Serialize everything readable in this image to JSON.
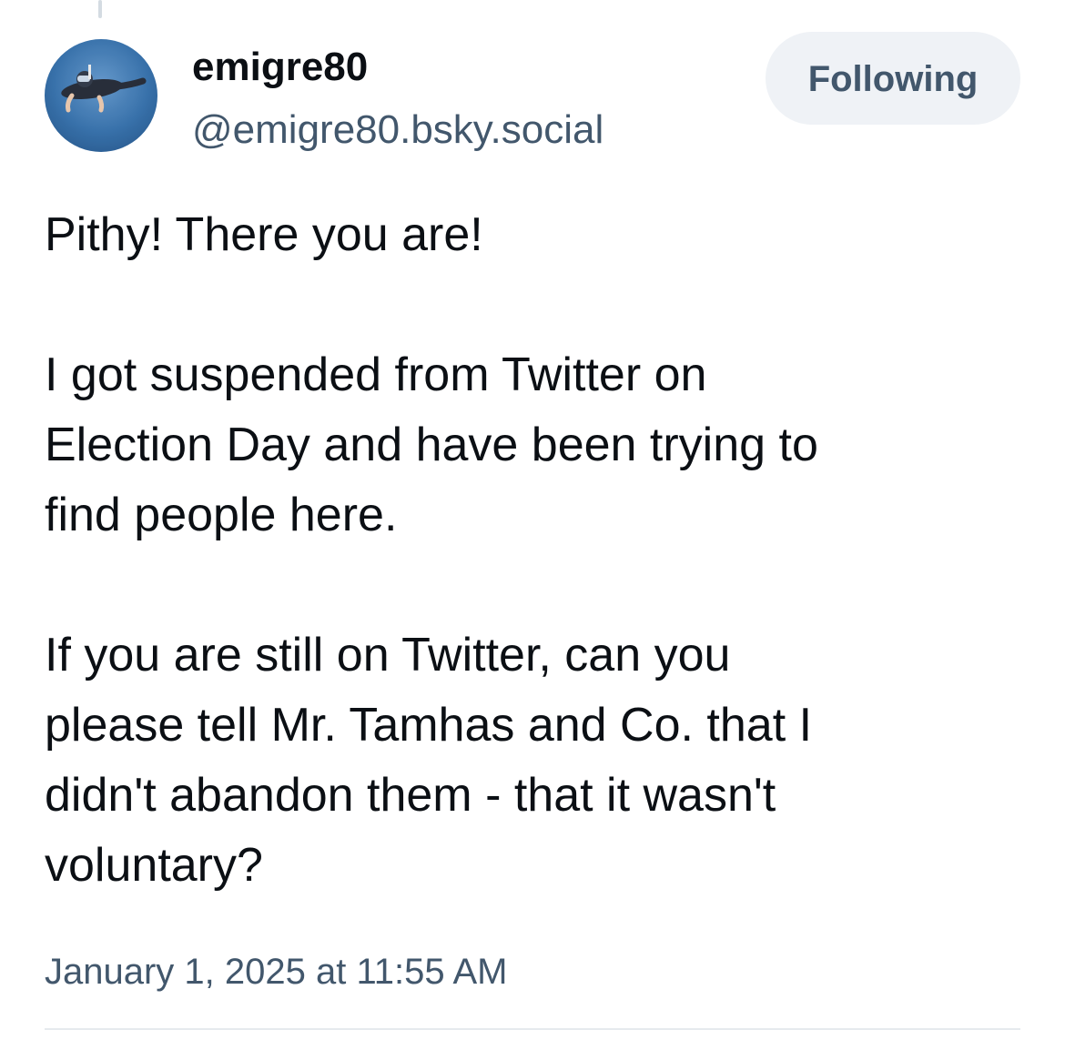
{
  "post": {
    "author": {
      "display_name": "emigre80",
      "handle": "@emigre80.bsky.social",
      "avatar_icon": "snorkeler-underwater-avatar"
    },
    "follow_button_label": "Following",
    "body": {
      "paragraph_1": "Pithy! There you are!",
      "paragraph_2": "I got suspended from Twitter on\nElection Day and have been trying to\nfind people here.",
      "paragraph_3": "If you are still on Twitter, can you\nplease tell Mr. Tamhas and Co. that I\ndidn't abandon them - that it wasn't\nvoluntary?"
    },
    "timestamp": "January 1, 2025 at 11:55 AM"
  },
  "colors": {
    "text_primary": "#0b0f14",
    "text_secondary": "#42576c",
    "button_bg": "#eff2f6",
    "divider": "#e6eaee"
  }
}
